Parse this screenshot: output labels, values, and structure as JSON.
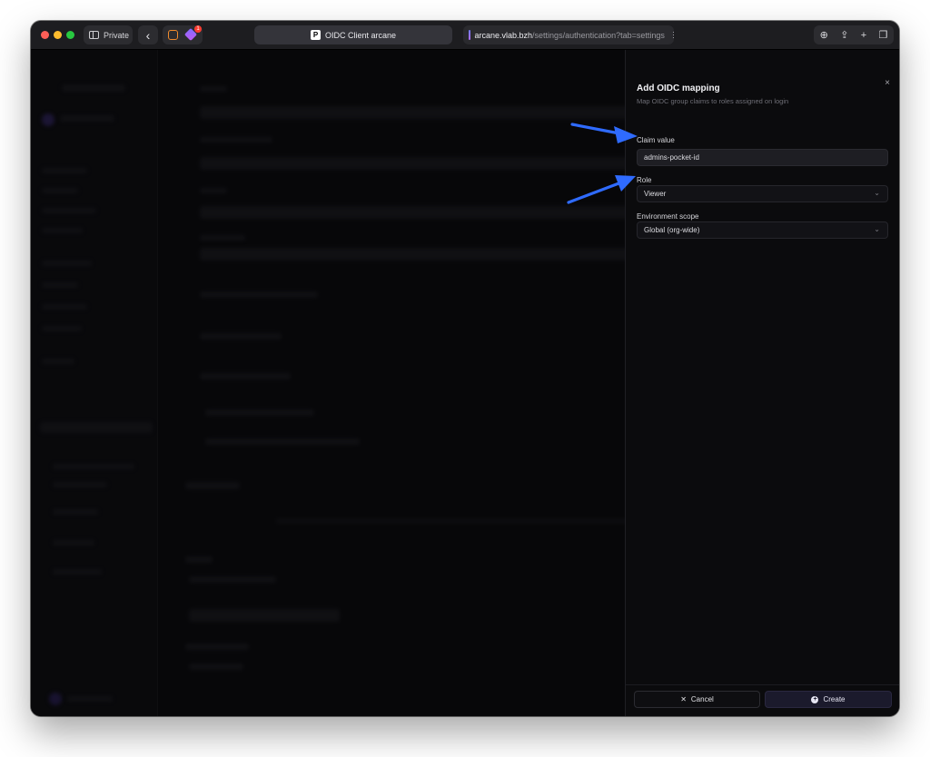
{
  "browser": {
    "private_label": "Private",
    "badge_count": "1",
    "tab_title": "OIDC Client arcane",
    "url_host": "arcane.vlab.bzh",
    "url_path": "/settings/authentication?tab=settings"
  },
  "drawer": {
    "title": "Add OIDC mapping",
    "subtitle": "Map OIDC group claims to roles assigned on login",
    "close_glyph": "×",
    "claim_label": "Claim value",
    "claim_value": "admins-pocket-id",
    "role_label": "Role",
    "role_value": "Viewer",
    "scope_label": "Environment scope",
    "scope_value": "Global (org-wide)",
    "cancel_label": "Cancel",
    "create_label": "Create"
  },
  "annotation": {
    "arrow_color": "#2f6bff"
  }
}
